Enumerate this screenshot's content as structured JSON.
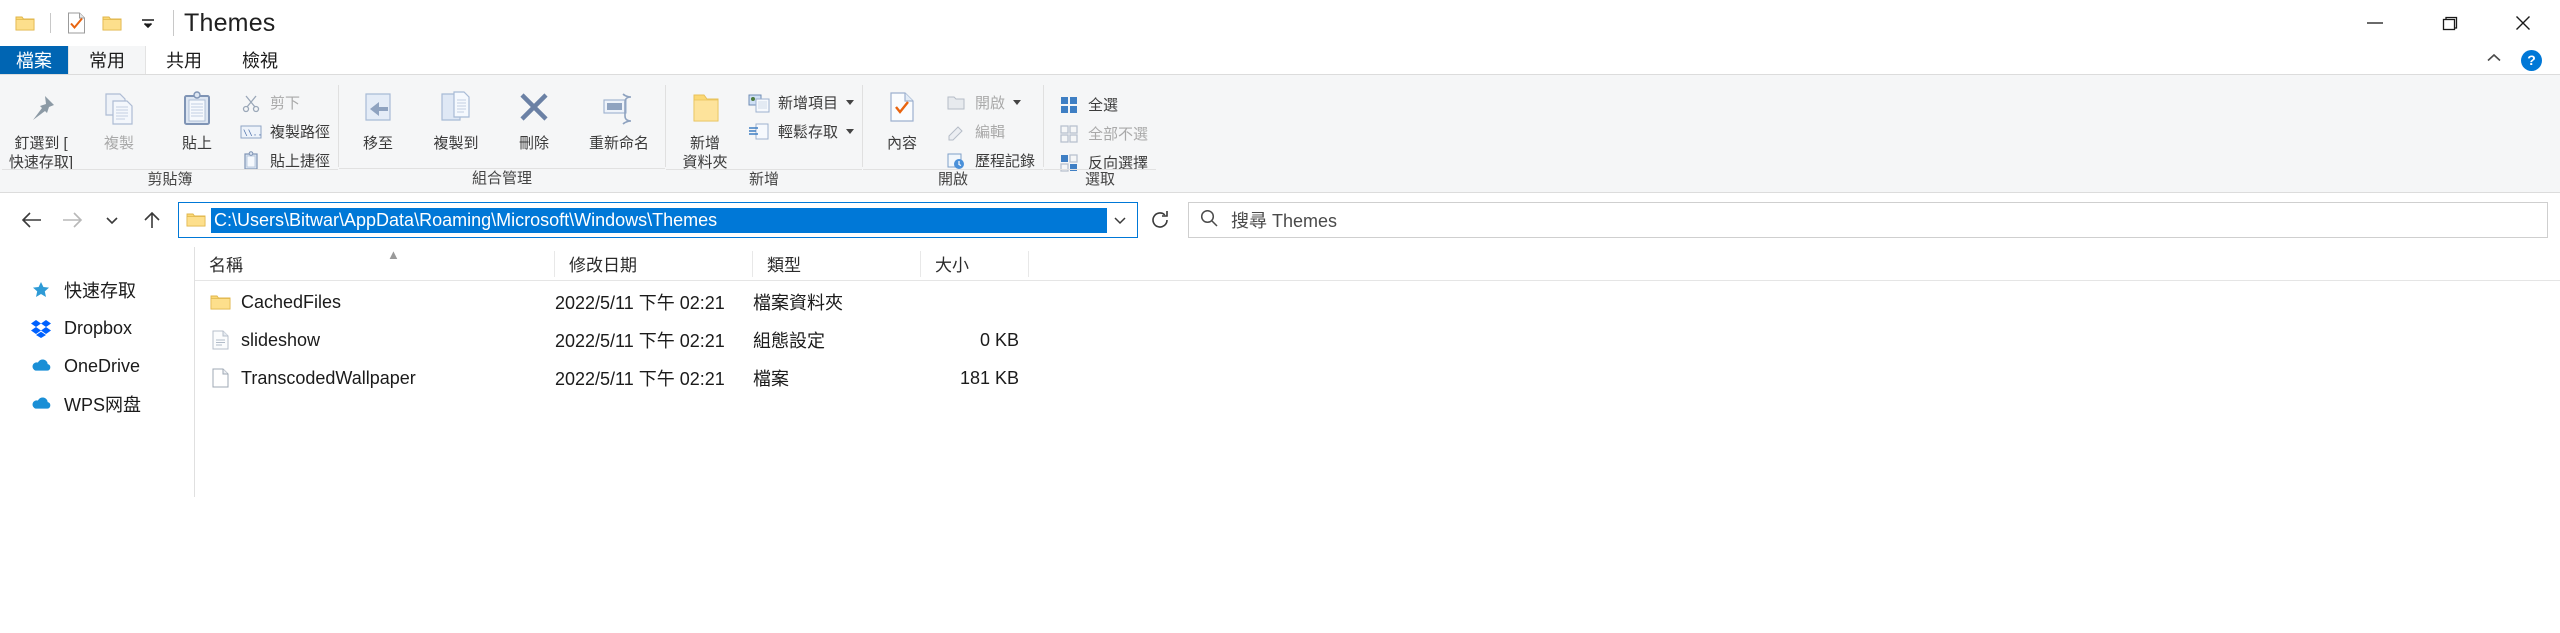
{
  "window": {
    "title": "Themes",
    "quick_access": [
      "folder-icon",
      "checked-document-icon",
      "folder-icon",
      "chevron-down-icon"
    ],
    "caption": {
      "minimize": "minimize-icon",
      "restore": "restore-icon",
      "close": "close-icon"
    }
  },
  "tabs": [
    {
      "label": "檔案",
      "name": "tab-file"
    },
    {
      "label": "常用",
      "name": "tab-home"
    },
    {
      "label": "共用",
      "name": "tab-share"
    },
    {
      "label": "檢視",
      "name": "tab-view"
    }
  ],
  "tabstrip_right": {
    "collapse": "chevron-up-icon",
    "help": "?"
  },
  "ribbon": {
    "groups": [
      {
        "name": "剪貼簿",
        "big": [
          {
            "label": "釘選到 [\n快速存取]",
            "icon": "pin-icon",
            "disabled": false
          },
          {
            "label": "複製",
            "icon": "copy-icon",
            "disabled": true
          },
          {
            "label": "貼上",
            "icon": "paste-icon",
            "disabled": false
          }
        ],
        "small": [
          {
            "label": "剪下",
            "icon": "scissors-icon",
            "disabled": true
          },
          {
            "label": "複製路徑",
            "icon": "copy-path-icon",
            "disabled": false
          },
          {
            "label": "貼上捷徑",
            "icon": "paste-shortcut-icon",
            "disabled": false
          }
        ]
      },
      {
        "name": "組合管理",
        "big": [
          {
            "label": "移至",
            "icon": "move-to-icon",
            "dropdown": true
          },
          {
            "label": "複製到",
            "icon": "copy-to-icon",
            "dropdown": true
          },
          {
            "label": "刪除",
            "icon": "delete-icon",
            "dropdown": true
          },
          {
            "label": "重新命名",
            "icon": "rename-icon",
            "dropdown": false
          }
        ]
      },
      {
        "name": "新增",
        "big": [
          {
            "label": "新增\n資料夾",
            "icon": "new-folder-icon"
          }
        ],
        "small": [
          {
            "label": "新增項目",
            "icon": "new-item-icon",
            "dropdown": true
          },
          {
            "label": "輕鬆存取",
            "icon": "easy-access-icon",
            "dropdown": true
          }
        ]
      },
      {
        "name": "開啟",
        "big": [
          {
            "label": "內容",
            "icon": "properties-icon",
            "dropdown": true
          }
        ],
        "small": [
          {
            "label": "開啟",
            "icon": "open-icon",
            "dropdown": true,
            "disabled": true
          },
          {
            "label": "編輯",
            "icon": "edit-icon",
            "disabled": true
          },
          {
            "label": "歷程記錄",
            "icon": "history-icon",
            "disabled": false
          }
        ]
      },
      {
        "name": "選取",
        "small": [
          {
            "label": "全選",
            "icon": "select-all-icon"
          },
          {
            "label": "全部不選",
            "icon": "select-none-icon",
            "disabled": true
          },
          {
            "label": "反向選擇",
            "icon": "invert-selection-icon"
          }
        ]
      }
    ]
  },
  "addressbar": {
    "back": "back-arrow-icon",
    "forward": "forward-arrow-icon",
    "recent": "chevron-down-icon",
    "up": "up-arrow-icon",
    "path": "C:\\Users\\Bitwar\\AppData\\Roaming\\Microsoft\\Windows\\Themes",
    "dropdown": "chevron-down-icon",
    "refresh": "refresh-icon",
    "search_placeholder": "搜尋 Themes",
    "search_icon": "search-icon",
    "selection_color": "#0078d7"
  },
  "navpane": {
    "items": [
      {
        "label": "快速存取",
        "icon": "star-icon",
        "name": "sidebar-item-quick-access"
      },
      {
        "label": "Dropbox",
        "icon": "dropbox-icon",
        "name": "sidebar-item-dropbox"
      },
      {
        "label": "OneDrive",
        "icon": "onedrive-icon",
        "name": "sidebar-item-onedrive"
      },
      {
        "label": "WPS网盘",
        "icon": "wps-cloud-icon",
        "name": "sidebar-item-wps-cloud"
      }
    ]
  },
  "filelist": {
    "columns": [
      {
        "label": "名稱",
        "name": "column-name"
      },
      {
        "label": "修改日期",
        "name": "column-date-modified"
      },
      {
        "label": "類型",
        "name": "column-type"
      },
      {
        "label": "大小",
        "name": "column-size"
      }
    ],
    "sort_indicator": "▲",
    "rows": [
      {
        "name": "CachedFiles",
        "date": "2022/5/11 下午 02:21",
        "type": "檔案資料夾",
        "size": "",
        "icon": "folder-icon"
      },
      {
        "name": "slideshow",
        "date": "2022/5/11 下午 02:21",
        "type": "組態設定",
        "size": "0 KB",
        "icon": "config-file-icon"
      },
      {
        "name": "TranscodedWallpaper",
        "date": "2022/5/11 下午 02:21",
        "type": "檔案",
        "size": "181 KB",
        "icon": "generic-file-icon"
      }
    ]
  }
}
